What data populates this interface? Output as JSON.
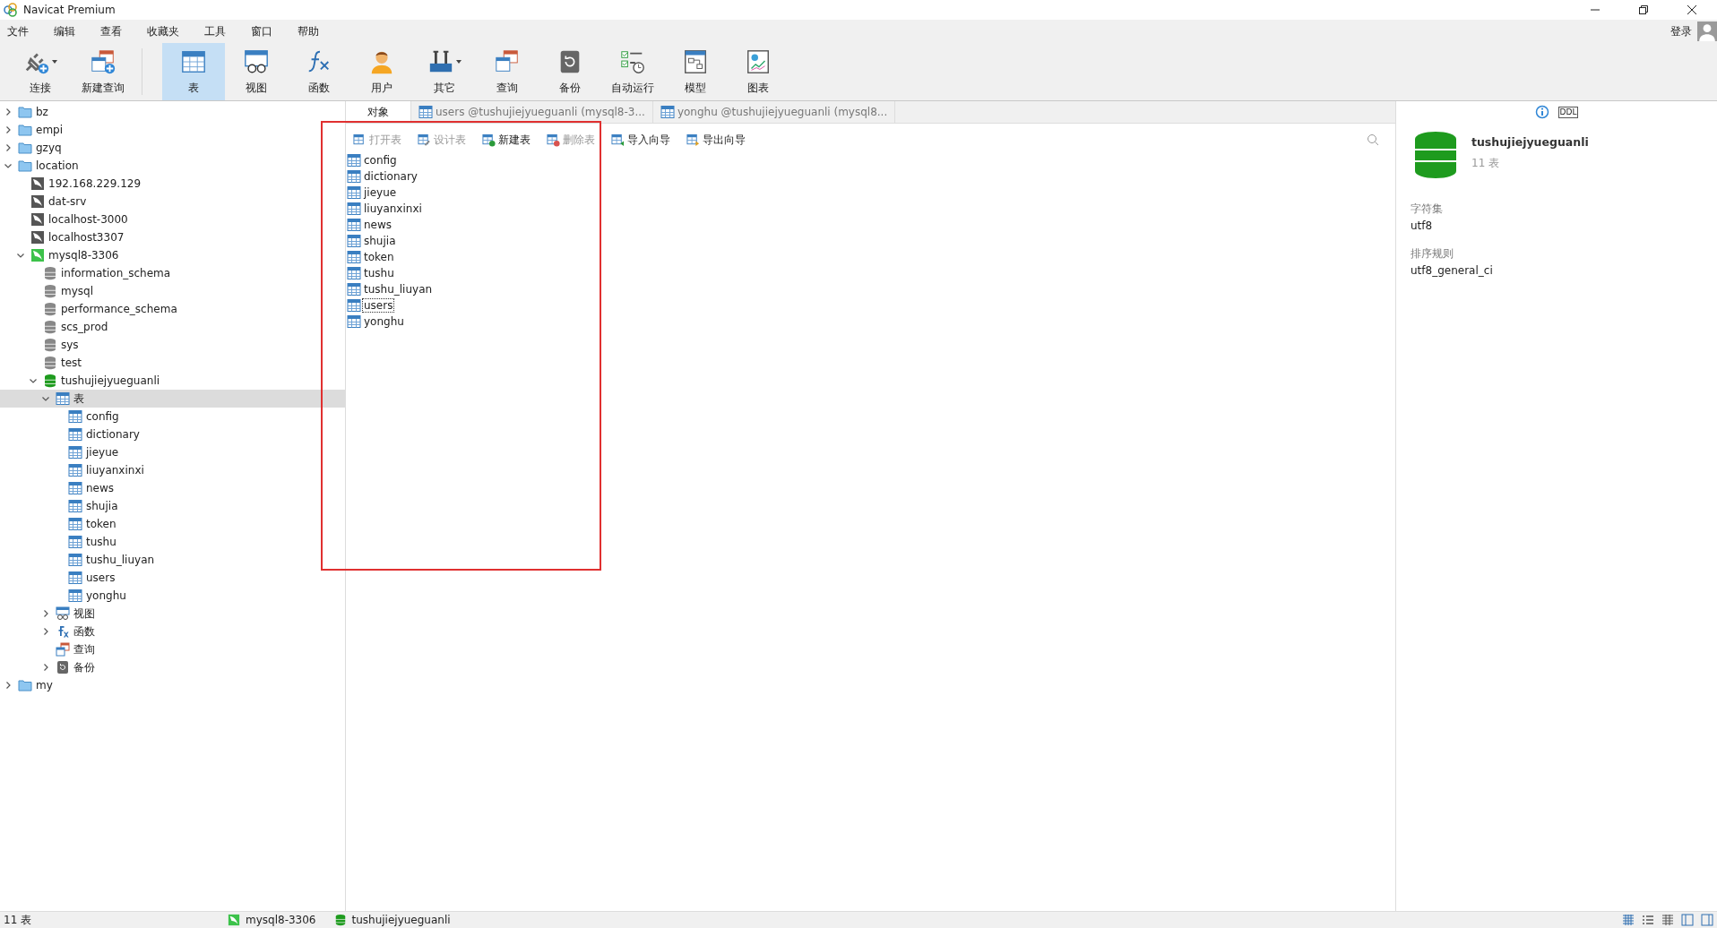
{
  "window": {
    "title": "Navicat Premium"
  },
  "menu": [
    "文件",
    "编辑",
    "查看",
    "收藏夹",
    "工具",
    "窗口",
    "帮助"
  ],
  "account": {
    "label": "登录"
  },
  "toolbar": [
    {
      "label": "连接",
      "kind": "connect",
      "selected": false,
      "dropdown": true
    },
    {
      "label": "新建查询",
      "kind": "newquery",
      "selected": false,
      "dropdown": false
    },
    {
      "label": "表",
      "kind": "table",
      "selected": true,
      "dropdown": false
    },
    {
      "label": "视图",
      "kind": "view",
      "selected": false,
      "dropdown": false
    },
    {
      "label": "函数",
      "kind": "function",
      "selected": false,
      "dropdown": false
    },
    {
      "label": "用户",
      "kind": "user",
      "selected": false,
      "dropdown": false
    },
    {
      "label": "其它",
      "kind": "tools",
      "selected": false,
      "dropdown": true
    },
    {
      "label": "查询",
      "kind": "query",
      "selected": false,
      "dropdown": false
    },
    {
      "label": "备份",
      "kind": "backup",
      "selected": false,
      "dropdown": false
    },
    {
      "label": "自动运行",
      "kind": "schedule",
      "selected": false,
      "dropdown": false
    },
    {
      "label": "模型",
      "kind": "model",
      "selected": false,
      "dropdown": false
    },
    {
      "label": "图表",
      "kind": "chart",
      "selected": false,
      "dropdown": false
    }
  ],
  "tree": [
    {
      "label": "bz",
      "kind": "folder",
      "expanded": false
    },
    {
      "label": "empi",
      "kind": "folder",
      "expanded": false
    },
    {
      "label": "gzyq",
      "kind": "folder",
      "expanded": false
    },
    {
      "label": "location",
      "kind": "folder",
      "expanded": true,
      "children": [
        {
          "label": "192.168.229.129",
          "kind": "connection",
          "active": false
        },
        {
          "label": "dat-srv",
          "kind": "connection",
          "active": false
        },
        {
          "label": "localhost-3000",
          "kind": "connection",
          "active": false
        },
        {
          "label": "localhost3307",
          "kind": "connection",
          "active": false
        },
        {
          "label": "mysql8-3306",
          "kind": "connection",
          "active": true,
          "expanded": true,
          "children": [
            {
              "label": "information_schema",
              "kind": "database",
              "active": false
            },
            {
              "label": "mysql",
              "kind": "database",
              "active": false
            },
            {
              "label": "performance_schema",
              "kind": "database",
              "active": false
            },
            {
              "label": "scs_prod",
              "kind": "database",
              "active": false
            },
            {
              "label": "sys",
              "kind": "database",
              "active": false
            },
            {
              "label": "test",
              "kind": "database",
              "active": false
            },
            {
              "label": "tushujiejyueguanli",
              "kind": "database",
              "active": true,
              "expanded": true,
              "children": [
                {
                  "label": "表",
                  "kind": "tables",
                  "expanded": true,
                  "selected": true,
                  "children": [
                    {
                      "label": "config",
                      "kind": "table"
                    },
                    {
                      "label": "dictionary",
                      "kind": "table"
                    },
                    {
                      "label": "jieyue",
                      "kind": "table"
                    },
                    {
                      "label": "liuyanxinxi",
                      "kind": "table"
                    },
                    {
                      "label": "news",
                      "kind": "table"
                    },
                    {
                      "label": "shujia",
                      "kind": "table"
                    },
                    {
                      "label": "token",
                      "kind": "table"
                    },
                    {
                      "label": "tushu",
                      "kind": "table"
                    },
                    {
                      "label": "tushu_liuyan",
                      "kind": "table"
                    },
                    {
                      "label": "users",
                      "kind": "table"
                    },
                    {
                      "label": "yonghu",
                      "kind": "table"
                    }
                  ]
                },
                {
                  "label": "视图",
                  "kind": "views",
                  "expanded": false
                },
                {
                  "label": "函数",
                  "kind": "functions",
                  "expanded": false
                },
                {
                  "label": "查询",
                  "kind": "queries"
                },
                {
                  "label": "备份",
                  "kind": "backups",
                  "expanded": false
                }
              ]
            }
          ]
        }
      ]
    },
    {
      "label": "my",
      "kind": "folder",
      "expanded": false
    }
  ],
  "tabs": [
    {
      "label": "对象",
      "kind": "objects",
      "selected": true
    },
    {
      "label": "users @tushujiejyueguanli (mysql8-3...",
      "kind": "table",
      "selected": false
    },
    {
      "label": "yonghu @tushujiejyueguanli (mysql8...",
      "kind": "table",
      "selected": false
    }
  ],
  "object_actions": [
    {
      "label": "打开表",
      "kind": "open",
      "disabled": true
    },
    {
      "label": "设计表",
      "kind": "design",
      "disabled": true
    },
    {
      "label": "新建表",
      "kind": "new",
      "disabled": false
    },
    {
      "label": "删除表",
      "kind": "delete",
      "disabled": true
    },
    {
      "label": "导入向导",
      "kind": "import",
      "disabled": false
    },
    {
      "label": "导出向导",
      "kind": "export",
      "disabled": false
    }
  ],
  "objects": [
    {
      "name": "config",
      "selected": false
    },
    {
      "name": "dictionary",
      "selected": false
    },
    {
      "name": "jieyue",
      "selected": false
    },
    {
      "name": "liuyanxinxi",
      "selected": false
    },
    {
      "name": "news",
      "selected": false
    },
    {
      "name": "shujia",
      "selected": false
    },
    {
      "name": "token",
      "selected": false
    },
    {
      "name": "tushu",
      "selected": false
    },
    {
      "name": "tushu_liuyan",
      "selected": false
    },
    {
      "name": "users",
      "selected": true
    },
    {
      "name": "yonghu",
      "selected": false
    }
  ],
  "info_panel": {
    "ddl_label": "DDL",
    "name": "tushujiejyueguanli",
    "count": "11 表",
    "fields": [
      {
        "label": "字符集",
        "value": "utf8"
      },
      {
        "label": "排序规则",
        "value": "utf8_general_ci"
      }
    ]
  },
  "status_bar": {
    "count": "11 表",
    "connection": "mysql8-3306",
    "database": "tushujiejyueguanli"
  }
}
